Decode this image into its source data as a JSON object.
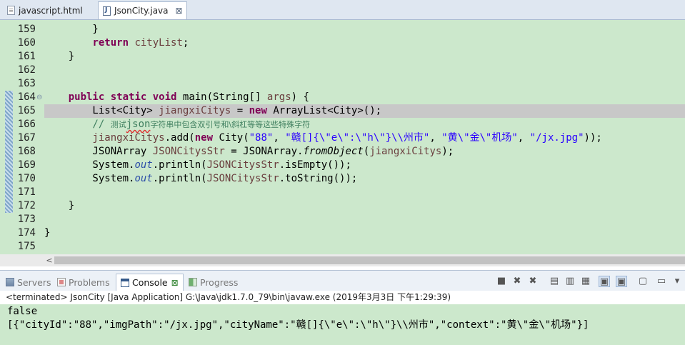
{
  "editor_tabs": [
    {
      "label": "javascript.html",
      "icon": "html-file-icon",
      "active": false
    },
    {
      "label": "JsonCity.java",
      "icon": "java-file-icon",
      "active": true
    }
  ],
  "editor": {
    "lines": [
      {
        "num": "159",
        "segs": [
          {
            "t": "        }"
          }
        ]
      },
      {
        "num": "160",
        "segs": [
          {
            "t": "        "
          },
          {
            "t": "return",
            "c": "kw"
          },
          {
            "t": " "
          },
          {
            "t": "cityList",
            "c": "var"
          },
          {
            "t": ";"
          }
        ]
      },
      {
        "num": "161",
        "segs": [
          {
            "t": "    }"
          }
        ]
      },
      {
        "num": "162",
        "segs": []
      },
      {
        "num": "163",
        "segs": []
      },
      {
        "num": "164",
        "fold": "⊖",
        "segs": [
          {
            "t": "    "
          },
          {
            "t": "public",
            "c": "kw"
          },
          {
            "t": " "
          },
          {
            "t": "static",
            "c": "kw"
          },
          {
            "t": " "
          },
          {
            "t": "void",
            "c": "kw"
          },
          {
            "t": " main(String[] "
          },
          {
            "t": "args",
            "c": "var"
          },
          {
            "t": ") {"
          }
        ]
      },
      {
        "num": "165",
        "current": true,
        "segs": [
          {
            "t": "        List<City> "
          },
          {
            "t": "jiangxiCitys",
            "c": "var"
          },
          {
            "t": " = "
          },
          {
            "t": "new",
            "c": "kw"
          },
          {
            "t": " ArrayList<City>();"
          }
        ]
      },
      {
        "num": "166",
        "segs": [
          {
            "t": "        // ",
            "c": "cmt"
          },
          {
            "t": "测试",
            "c": "cmt-cjk"
          },
          {
            "t": "json",
            "c": "cmt squig"
          },
          {
            "t": "字符串中包含双引号和\\斜杠等等这些特殊字符",
            "c": "cmt-cjk"
          }
        ]
      },
      {
        "num": "167",
        "segs": [
          {
            "t": "        "
          },
          {
            "t": "jiangxiCitys",
            "c": "var"
          },
          {
            "t": ".add("
          },
          {
            "t": "new",
            "c": "kw"
          },
          {
            "t": " City("
          },
          {
            "t": "\"88\"",
            "c": "str"
          },
          {
            "t": ", "
          },
          {
            "t": "\"赣[]{\\\"e\\\":\\\"h\\\"}\\\\州市\"",
            "c": "str"
          },
          {
            "t": ", "
          },
          {
            "t": "\"黄\\\"金\\\"机场\"",
            "c": "str"
          },
          {
            "t": ", "
          },
          {
            "t": "\"/jx.jpg\"",
            "c": "str"
          },
          {
            "t": "));"
          }
        ]
      },
      {
        "num": "168",
        "segs": [
          {
            "t": "        JSONArray "
          },
          {
            "t": "JSONCitysStr",
            "c": "var"
          },
          {
            "t": " = JSONArray."
          },
          {
            "t": "fromObject",
            "c": "ital"
          },
          {
            "t": "("
          },
          {
            "t": "jiangxiCitys",
            "c": "var"
          },
          {
            "t": ");"
          }
        ]
      },
      {
        "num": "169",
        "segs": [
          {
            "t": "        System."
          },
          {
            "t": "out",
            "c": "fld"
          },
          {
            "t": ".println("
          },
          {
            "t": "JSONCitysStr",
            "c": "var"
          },
          {
            "t": ".isEmpty());"
          }
        ]
      },
      {
        "num": "170",
        "segs": [
          {
            "t": "        System."
          },
          {
            "t": "out",
            "c": "fld"
          },
          {
            "t": ".println("
          },
          {
            "t": "JSONCitysStr",
            "c": "var"
          },
          {
            "t": ".toString());"
          }
        ]
      },
      {
        "num": "171",
        "segs": []
      },
      {
        "num": "172",
        "segs": [
          {
            "t": "    }"
          }
        ]
      },
      {
        "num": "173",
        "segs": []
      },
      {
        "num": "174",
        "segs": [
          {
            "t": "}"
          }
        ]
      },
      {
        "num": "175",
        "segs": []
      }
    ]
  },
  "view_tabs": [
    {
      "label": "Servers",
      "icon": "servers-icon",
      "active": false
    },
    {
      "label": "Problems",
      "icon": "problems-icon",
      "active": false
    },
    {
      "label": "Console",
      "icon": "console-icon",
      "active": true,
      "close": "⊠"
    },
    {
      "label": "Progress",
      "icon": "progress-icon",
      "active": false
    }
  ],
  "console_toolbar": [
    {
      "icon": "stop-icon",
      "glyph": "■"
    },
    {
      "icon": "remove-launch-icon",
      "glyph": "✖"
    },
    {
      "icon": "remove-all-terminated-icon",
      "glyph": "✖"
    },
    {
      "icon": "clear-console-icon",
      "glyph": "▤"
    },
    {
      "icon": "scroll-lock-icon",
      "glyph": "▥"
    },
    {
      "icon": "word-wrap-icon",
      "glyph": "▦"
    },
    {
      "icon": "show-on-stdout-icon",
      "glyph": "▣",
      "on": true
    },
    {
      "icon": "show-on-stderr-icon",
      "glyph": "▣",
      "on": true
    },
    {
      "icon": "pin-console-icon",
      "glyph": "▢"
    },
    {
      "icon": "display-selected-console-icon",
      "glyph": "▭"
    },
    {
      "icon": "display-selected-dropdown-icon",
      "glyph": "▾"
    },
    {
      "icon": "open-console-icon",
      "glyph": "▤"
    },
    {
      "icon": "view-menu-icon",
      "glyph": "▾"
    }
  ],
  "console": {
    "status": "<terminated> JsonCity [Java Application] G:\\Java\\jdk1.7.0_79\\bin\\javaw.exe (2019年3月3日 下午1:29:39)",
    "output": [
      "false",
      "[{\"cityId\":\"88\",\"imgPath\":\"/jx.jpg\",\"cityName\":\"赣[]{\\\"e\\\":\\\"h\\\"}\\\\州市\",\"context\":\"黄\\\"金\\\"机场\"}]"
    ]
  }
}
